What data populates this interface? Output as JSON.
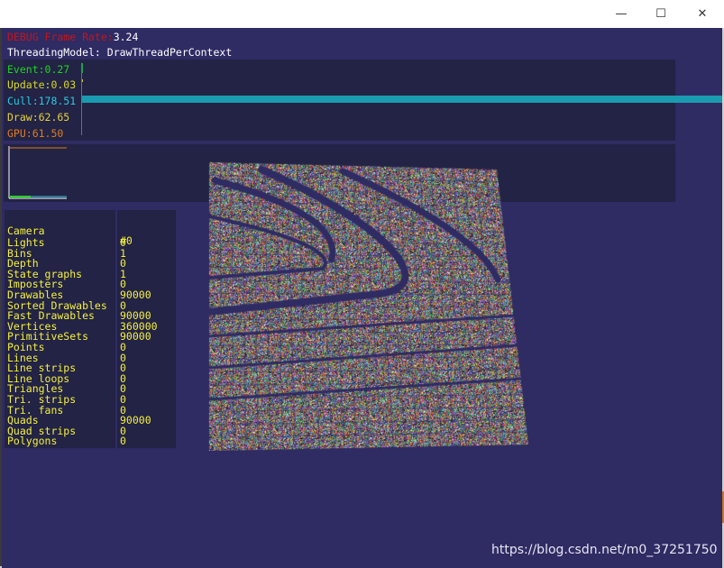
{
  "window": {
    "minimize_glyph": "—",
    "maximize_glyph": "☐",
    "close_glyph": "✕"
  },
  "hud": {
    "fps_label": "DEBUG Frame Rate:",
    "fps_value": "3.24",
    "threading": "ThreadingModel: DrawThreadPerContext",
    "timings": {
      "event": "Event:0.27",
      "update": "Update:0.03",
      "cull": "Cull:178.51",
      "draw": "Draw:62.65",
      "gpu": "GPU:61.50"
    },
    "colors": {
      "event": "#1fd51f",
      "update": "#d8d82a",
      "cull": "#2ec9e0",
      "draw": "#e6d23a",
      "gpu": "#e07b1f",
      "panel": "#222345",
      "background": "#2f2b63",
      "stats_text": "#f5f03c"
    }
  },
  "stats": {
    "camera_label": "Camera",
    "camera_value": "#0",
    "rows": [
      {
        "label": "Lights",
        "value": "0"
      },
      {
        "label": "Bins",
        "value": "1"
      },
      {
        "label": "Depth",
        "value": "0"
      },
      {
        "label": "State graphs",
        "value": "1"
      },
      {
        "label": "Imposters",
        "value": "0"
      },
      {
        "label": "Drawables",
        "value": "90000"
      },
      {
        "label": "Sorted Drawables",
        "value": "0"
      },
      {
        "label": "Fast Drawables",
        "value": "90000"
      },
      {
        "label": "Vertices",
        "value": "360000"
      },
      {
        "label": "PrimitiveSets",
        "value": "90000"
      },
      {
        "label": "Points",
        "value": "0"
      },
      {
        "label": "Lines",
        "value": "0"
      },
      {
        "label": "Line strips",
        "value": "0"
      },
      {
        "label": "Line loops",
        "value": "0"
      },
      {
        "label": "Triangles",
        "value": "0"
      },
      {
        "label": "Tri. strips",
        "value": "0"
      },
      {
        "label": "Tri. fans",
        "value": "0"
      },
      {
        "label": "Quads",
        "value": "90000"
      },
      {
        "label": "Quad strips",
        "value": "0"
      },
      {
        "label": "Polygons",
        "value": "0"
      }
    ]
  },
  "watermark": "https://blog.csdn.net/m0_37251750"
}
